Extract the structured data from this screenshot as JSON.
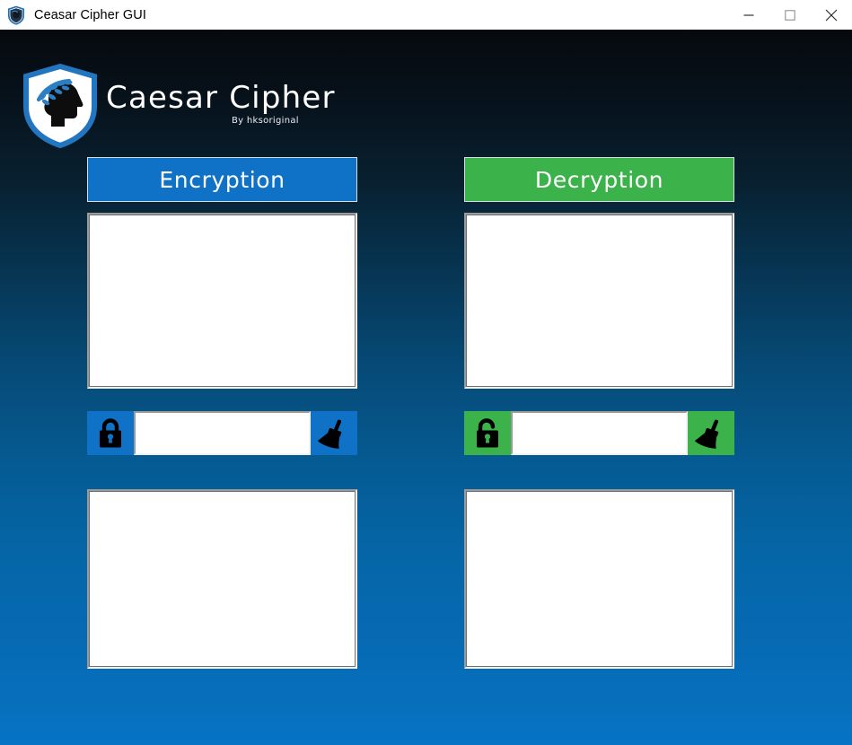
{
  "window": {
    "title": "Ceasar Cipher GUI",
    "app_icon": "shield-icon",
    "controls": {
      "minimize_label": "Minimize",
      "maximize_label": "Maximize",
      "close_label": "Close"
    }
  },
  "header": {
    "logo_icon": "caesar-shield-logo",
    "brand": "Caesar Cipher",
    "byline": "By hksoriginal"
  },
  "colors": {
    "encryption_accent": "#1072c6",
    "decryption_accent": "#3cb24b",
    "background_top": "#060a0e",
    "background_bottom": "#0674c4",
    "title_text": "#ffffff",
    "icon_fill": "#000000"
  },
  "panels": [
    {
      "id": "encryption",
      "title": "Encryption",
      "accent": "#1072c6",
      "input_textarea": {
        "name": "encryption-input-textarea",
        "value": "",
        "placeholder": ""
      },
      "key_field": {
        "name": "encryption-key-input",
        "value": "",
        "placeholder": ""
      },
      "action_icon": "lock-closed-icon",
      "clear_icon": "broom-icon",
      "output_textarea": {
        "name": "encryption-output-textarea",
        "value": "",
        "placeholder": ""
      }
    },
    {
      "id": "decryption",
      "title": "Decryption",
      "accent": "#3cb24b",
      "input_textarea": {
        "name": "decryption-input-textarea",
        "value": "",
        "placeholder": ""
      },
      "key_field": {
        "name": "decryption-key-input",
        "value": "",
        "placeholder": ""
      },
      "action_icon": "lock-open-icon",
      "clear_icon": "broom-icon",
      "output_textarea": {
        "name": "decryption-output-textarea",
        "value": "",
        "placeholder": ""
      }
    }
  ]
}
